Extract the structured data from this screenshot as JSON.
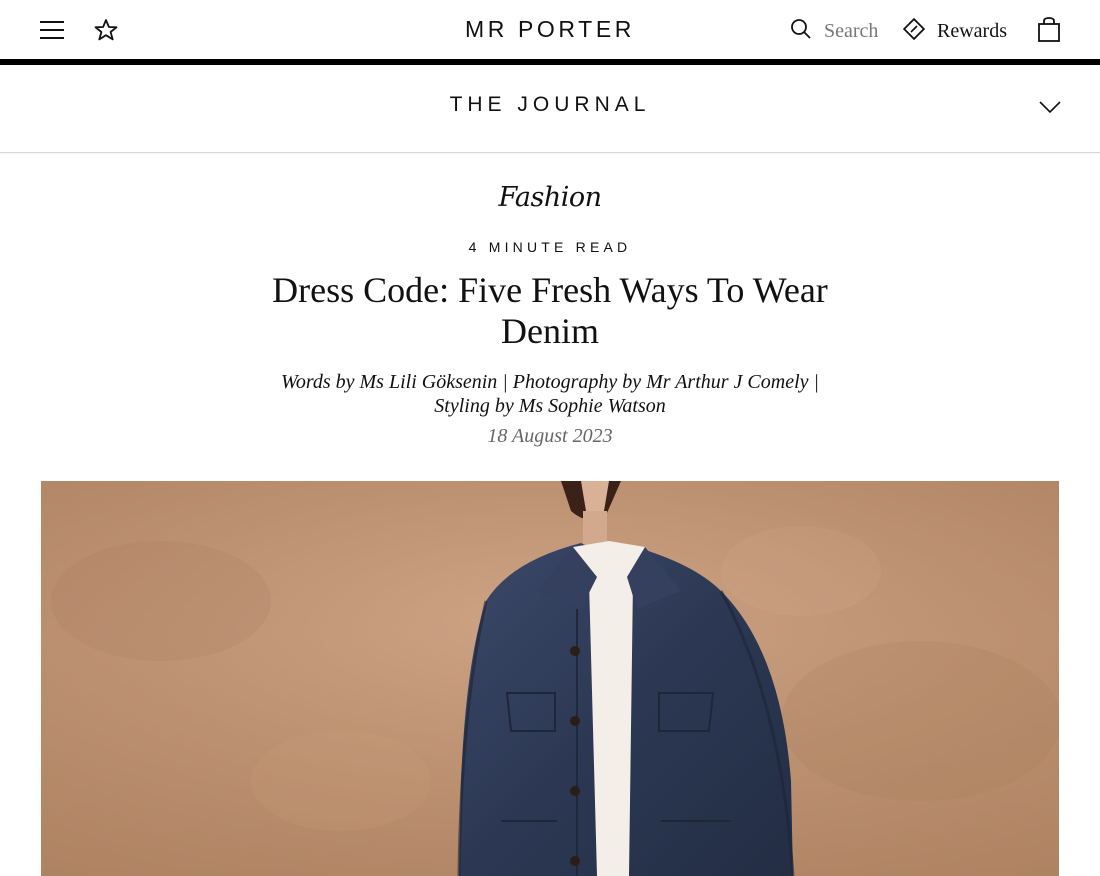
{
  "header": {
    "brand": "MR PORTER",
    "search_label": "Search",
    "rewards_label": "Rewards",
    "icons": [
      "menu-icon",
      "star-icon",
      "search-icon",
      "rewards-icon",
      "bag-icon"
    ]
  },
  "journal": {
    "title": "THE JOURNAL",
    "icon": "chevron-down-icon"
  },
  "article": {
    "category": "Fashion",
    "read_time": "4 MINUTE READ",
    "headline_line1": "Dress Code: Five Fresh Ways To Wear",
    "headline_line2": "Denim",
    "credits_line1": "Words by Ms Lili Göksenin | Photography by Mr Arthur J Comely |",
    "credits_line2": "Styling by Ms Sophie Watson",
    "date": "18 August 2023"
  },
  "colors": {
    "accent": "#000000",
    "muted_text": "#777777",
    "hero_background": "#b88e6d",
    "denim": "#2f3b57"
  }
}
